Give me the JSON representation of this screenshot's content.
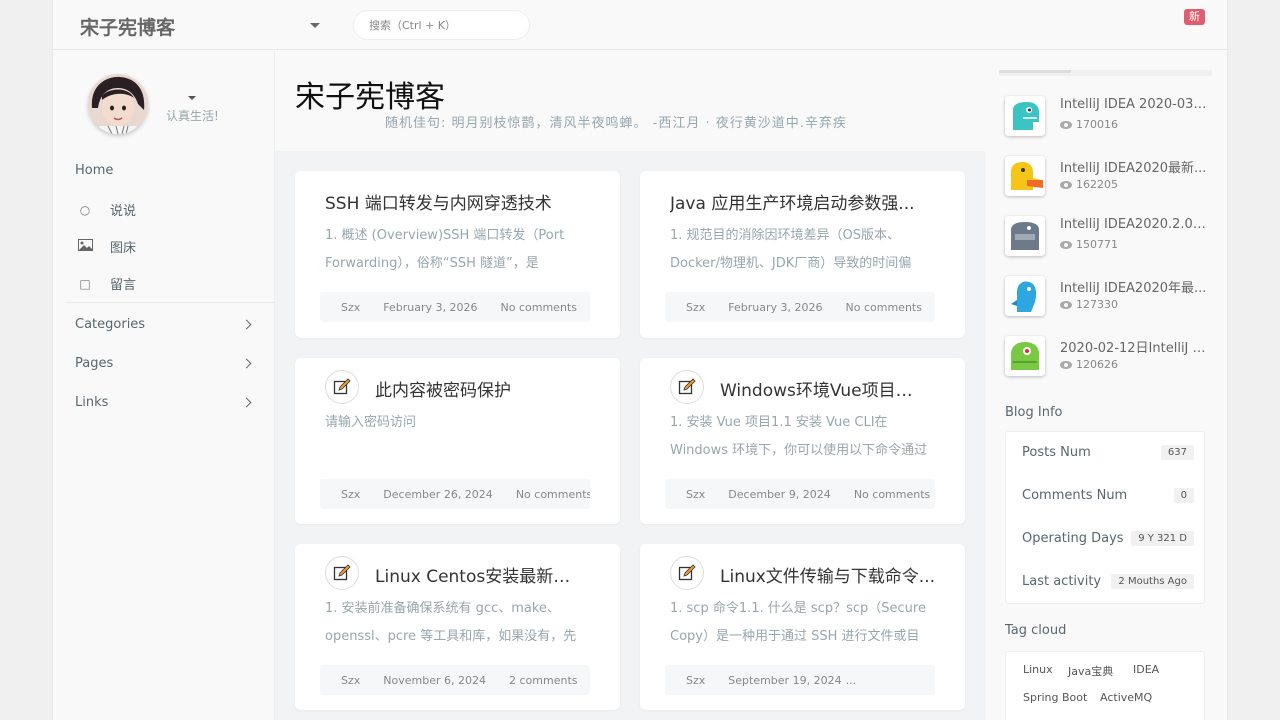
{
  "header": {
    "brand": "宋子宪博客",
    "search_placeholder": "搜索（Ctrl + K）",
    "badge": "新"
  },
  "user": {
    "motto": "认真生活!"
  },
  "nav": {
    "home": "Home",
    "items": [
      {
        "label": "说说",
        "icon": "comment-icon"
      },
      {
        "label": "图床",
        "icon": "image-icon"
      },
      {
        "label": "留言",
        "icon": "message-icon"
      }
    ],
    "groups": [
      "Categories",
      "Pages",
      "Links"
    ]
  },
  "main": {
    "title": "宋子宪博客",
    "quote": "随机佳句: 明月别枝惊鹊，清风半夜鸣蝉。 -西江月 · 夜行黄沙道中.辛弃疾",
    "posts": [
      {
        "title": "SSH 端口转发与内网穿透技术",
        "excerpt": "1. 概述 (Overview)SSH 端口转发（Port Forwarding），俗称“SSH 隧道”，是",
        "author": "Szx",
        "date": "February 3, 2026",
        "comments": "No comments",
        "locked": false
      },
      {
        "title": "Java 应用生产环境启动参数强...",
        "excerpt": "1. 规范目的消除因环境差异（OS版本、Docker/物理机、JDK厂商）导致的时间偏",
        "author": "Szx",
        "date": "February 3, 2026",
        "comments": "No comments",
        "locked": false
      },
      {
        "title": "此内容被密码保护",
        "excerpt": "请输入密码访问",
        "author": "Szx",
        "date": "December 26, 2024",
        "comments": "No comments",
        "locked": true
      },
      {
        "title": "Windows环境Vue项目常...",
        "excerpt": "1. 安装 Vue 项目1.1 安装 Vue CLI在 Windows 环境下，你可以使用以下命令通过 npm 安",
        "author": "Szx",
        "date": "December 9, 2024",
        "comments": "No comments",
        "locked": true
      },
      {
        "title": "Linux Centos安装最新稳...",
        "excerpt": "1. 安装前准备确保系统有 gcc、make、openssl、pcre 等工具和库，如果没有，先",
        "author": "Szx",
        "date": "November 6, 2024",
        "comments": "2 comments",
        "locked": true
      },
      {
        "title": "Linux文件传输与下载命令...",
        "excerpt": "1. scp 命令1.1. 什么是 scp？scp（Secure Copy）是一种用于通过 SSH 进行文件或目",
        "author": "Szx",
        "date": "September 19, 2024",
        "comments": "...",
        "locked": true
      }
    ]
  },
  "sidebar": {
    "hot": [
      {
        "title": "IntelliJ IDEA 2020-03-1...",
        "views": "170016",
        "color": "#3cc4c4"
      },
      {
        "title": "IntelliJ IDEA2020最新...",
        "views": "162205",
        "color": "#f5c518"
      },
      {
        "title": "IntelliJ IDEA2020.2.04...",
        "views": "150771",
        "color": "#6c7a89"
      },
      {
        "title": "IntelliJ IDEA2020年最...",
        "views": "127330",
        "color": "#2ea6e0"
      },
      {
        "title": "2020-02-12日IntelliJ ID...",
        "views": "120626",
        "color": "#7ac943"
      }
    ],
    "blog_info_title": "Blog Info",
    "blog_info": [
      {
        "label": "Posts Num",
        "value": "637"
      },
      {
        "label": "Comments Num",
        "value": "0"
      },
      {
        "label": "Operating Days",
        "value": "9 Y 321 D"
      },
      {
        "label": "Last activity",
        "value": "2 Mouths Ago"
      }
    ],
    "tag_cloud_title": "Tag cloud",
    "tags": [
      "Linux",
      "Java宝典",
      "IDEA",
      "Spring Boot",
      "ActiveMQ"
    ]
  }
}
